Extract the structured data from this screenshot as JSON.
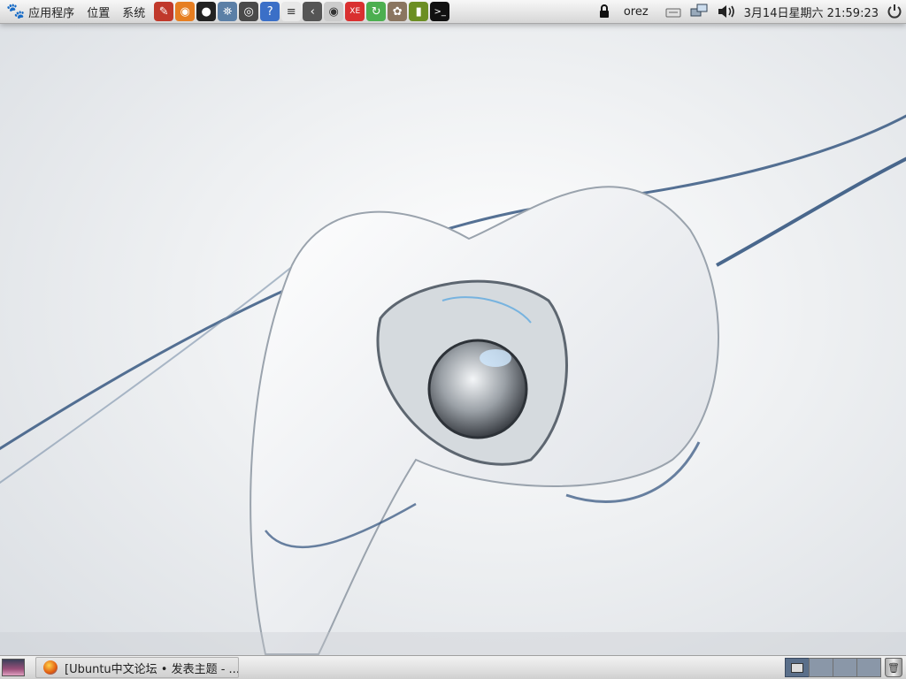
{
  "top_panel": {
    "menus": [
      "应用程序",
      "位置",
      "系统"
    ],
    "launchers": [
      {
        "name": "color-palette-icon",
        "bg": "#c0392b"
      },
      {
        "name": "firefox-icon",
        "bg": "#e67e22"
      },
      {
        "name": "qq-penguin-icon",
        "bg": "#222222"
      },
      {
        "name": "network-tool-icon",
        "bg": "#5b7fa6"
      },
      {
        "name": "disc-icon",
        "bg": "#4a4a4a"
      },
      {
        "name": "help-icon",
        "bg": "#3b6fc7"
      },
      {
        "name": "text-editor-icon",
        "bg": "#e8e8e8"
      },
      {
        "name": "back-arrow-icon",
        "bg": "#555555"
      },
      {
        "name": "eye-viewer-icon",
        "bg": "#cccccc"
      },
      {
        "name": "xe-app-icon",
        "bg": "#d93030"
      },
      {
        "name": "green-arrow-icon",
        "bg": "#4caf50"
      },
      {
        "name": "gimp-icon",
        "bg": "#8a7560"
      },
      {
        "name": "dictionary-book-icon",
        "bg": "#6b8e23"
      },
      {
        "name": "terminal-icon",
        "bg": "#111111"
      }
    ],
    "user": "orez",
    "clock": "3月14日星期六 21:59:23"
  },
  "bottom_panel": {
    "task_label": "[Ubuntu中文论坛 • 发表主题 - ...",
    "workspaces": 4
  }
}
